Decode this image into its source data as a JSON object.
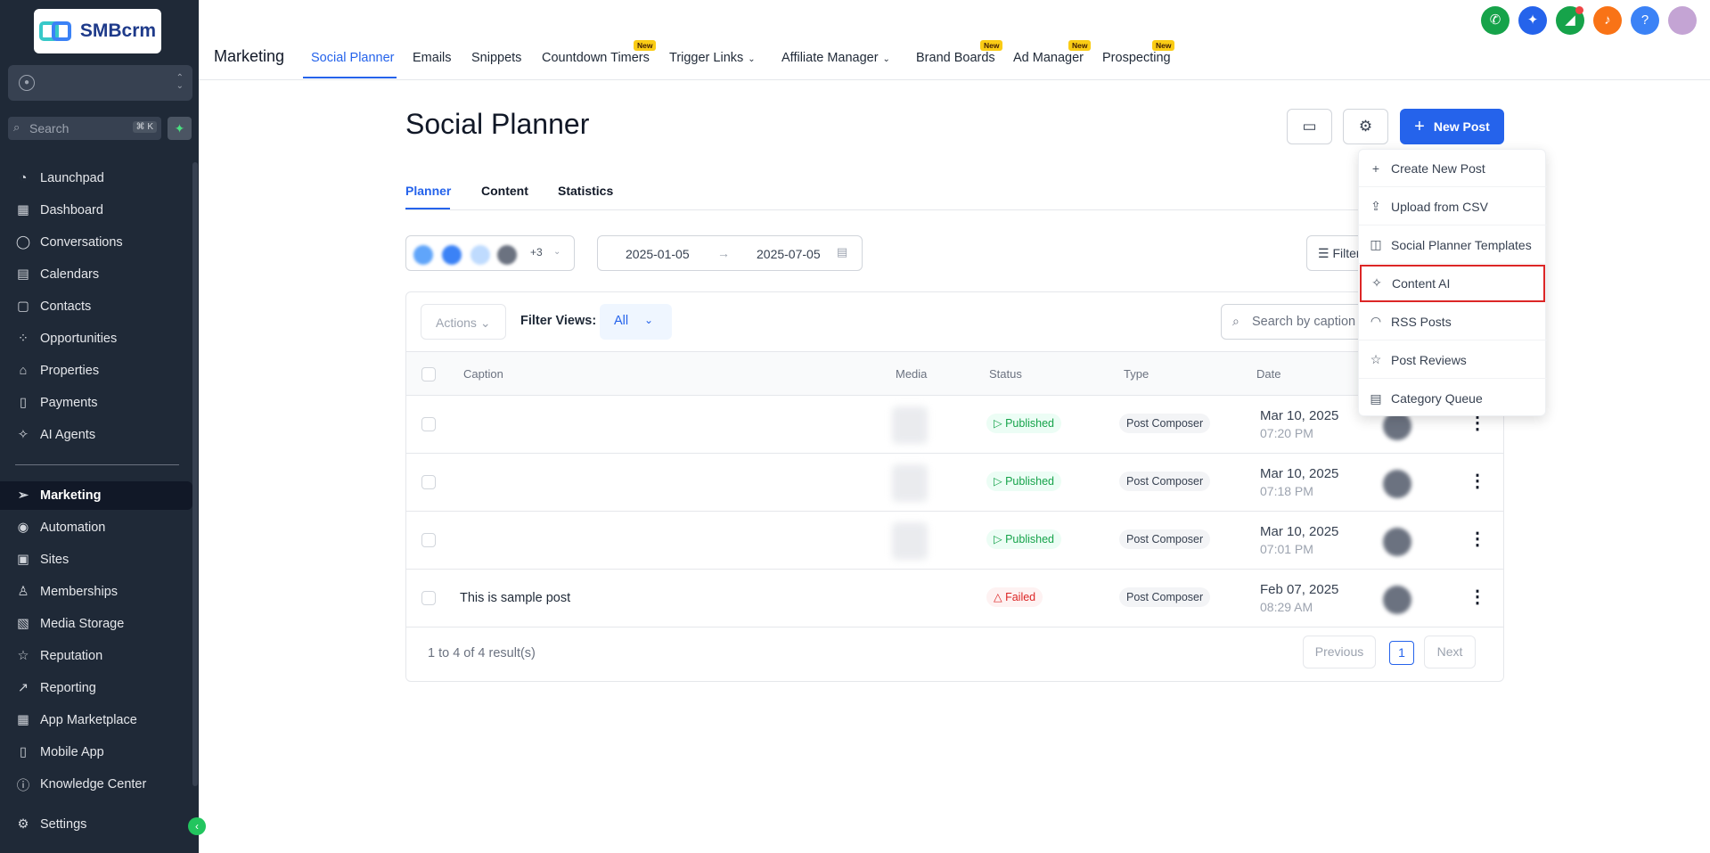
{
  "sidebar": {
    "logo_text": "SMBcrm",
    "search_placeholder": "Search",
    "search_shortcut": "⌘ K",
    "items": [
      {
        "label": "Launchpad",
        "icon": "rocket-icon"
      },
      {
        "label": "Dashboard",
        "icon": "grid-icon"
      },
      {
        "label": "Conversations",
        "icon": "chat-icon"
      },
      {
        "label": "Calendars",
        "icon": "calendar-icon"
      },
      {
        "label": "Contacts",
        "icon": "contacts-icon"
      },
      {
        "label": "Opportunities",
        "icon": "funnel-icon"
      },
      {
        "label": "Properties",
        "icon": "home-icon"
      },
      {
        "label": "Payments",
        "icon": "receipt-icon"
      },
      {
        "label": "AI Agents",
        "icon": "sparkle-icon"
      },
      {
        "label": "Marketing",
        "icon": "send-icon"
      },
      {
        "label": "Automation",
        "icon": "automation-icon"
      },
      {
        "label": "Sites",
        "icon": "sites-icon"
      },
      {
        "label": "Memberships",
        "icon": "membership-icon"
      },
      {
        "label": "Media Storage",
        "icon": "image-icon"
      },
      {
        "label": "Reputation",
        "icon": "star-icon"
      },
      {
        "label": "Reporting",
        "icon": "trend-icon"
      },
      {
        "label": "App Marketplace",
        "icon": "apps-icon"
      },
      {
        "label": "Mobile App",
        "icon": "mobile-icon"
      },
      {
        "label": "Knowledge Center",
        "icon": "info-icon"
      },
      {
        "label": "Settings",
        "icon": "gear-icon"
      }
    ]
  },
  "topnav": {
    "section_title": "Marketing",
    "tabs": [
      {
        "label": "Social Planner",
        "active": true
      },
      {
        "label": "Emails"
      },
      {
        "label": "Snippets"
      },
      {
        "label": "Countdown Timers",
        "badge": "New"
      },
      {
        "label": "Trigger Links"
      },
      {
        "label": "Affiliate Manager"
      },
      {
        "label": "Brand Boards",
        "badge": "New"
      },
      {
        "label": "Ad Manager",
        "badge": "New"
      },
      {
        "label": "Prospecting",
        "badge": "New"
      }
    ],
    "header_icons": [
      {
        "name": "phone-icon",
        "color": "#16a34a"
      },
      {
        "name": "ai-sparkle-icon",
        "color": "#2563eb"
      },
      {
        "name": "megaphone-icon",
        "color": "#16a34a"
      },
      {
        "name": "bell-icon",
        "color": "#f97316"
      },
      {
        "name": "help-icon",
        "color": "#3b82f6"
      }
    ]
  },
  "page": {
    "title": "Social Planner",
    "new_post_label": "New Post",
    "subtabs": [
      "Planner",
      "Content",
      "Statistics"
    ],
    "accounts_extra": "+3",
    "date_from": "2025-01-05",
    "date_to": "2025-07-05",
    "filter_label": "Filters",
    "actions_label": "Actions",
    "filter_views_label": "Filter Views:",
    "filter_views_value": "All",
    "search_placeholder": "Search by caption"
  },
  "table": {
    "columns": [
      "Caption",
      "Media",
      "Status",
      "Type",
      "Date"
    ],
    "rows": [
      {
        "caption": "",
        "status": "Published",
        "type": "Post Composer",
        "date": "Mar 10, 2025",
        "time": "07:20 PM"
      },
      {
        "caption": "",
        "status": "Published",
        "type": "Post Composer",
        "date": "Mar 10, 2025",
        "time": "07:18 PM"
      },
      {
        "caption": "",
        "status": "Published",
        "type": "Post Composer",
        "date": "Mar 10, 2025",
        "time": "07:01 PM"
      },
      {
        "caption": "This is sample post",
        "status": "Failed",
        "type": "Post Composer",
        "date": "Feb 07, 2025",
        "time": "08:29 AM"
      }
    ],
    "results_text": "1 to 4 of 4 result(s)",
    "prev_label": "Previous",
    "next_label": "Next",
    "current_page": "1"
  },
  "dropdown": {
    "items": [
      {
        "label": "Create New Post",
        "icon": "plus-icon"
      },
      {
        "label": "Upload from CSV",
        "icon": "upload-icon"
      },
      {
        "label": "Social Planner Templates",
        "icon": "template-icon"
      },
      {
        "label": "Content AI",
        "icon": "ai-wand-icon",
        "highlighted": true
      },
      {
        "label": "RSS Posts",
        "icon": "rss-icon"
      },
      {
        "label": "Post Reviews",
        "icon": "star-icon"
      },
      {
        "label": "Category Queue",
        "icon": "queue-icon"
      }
    ]
  },
  "colors": {
    "accent": "#2563eb",
    "sidebar_bg": "#1f2937",
    "published": "#16a34a",
    "failed": "#dc2626",
    "highlight_border": "#dc2626"
  }
}
